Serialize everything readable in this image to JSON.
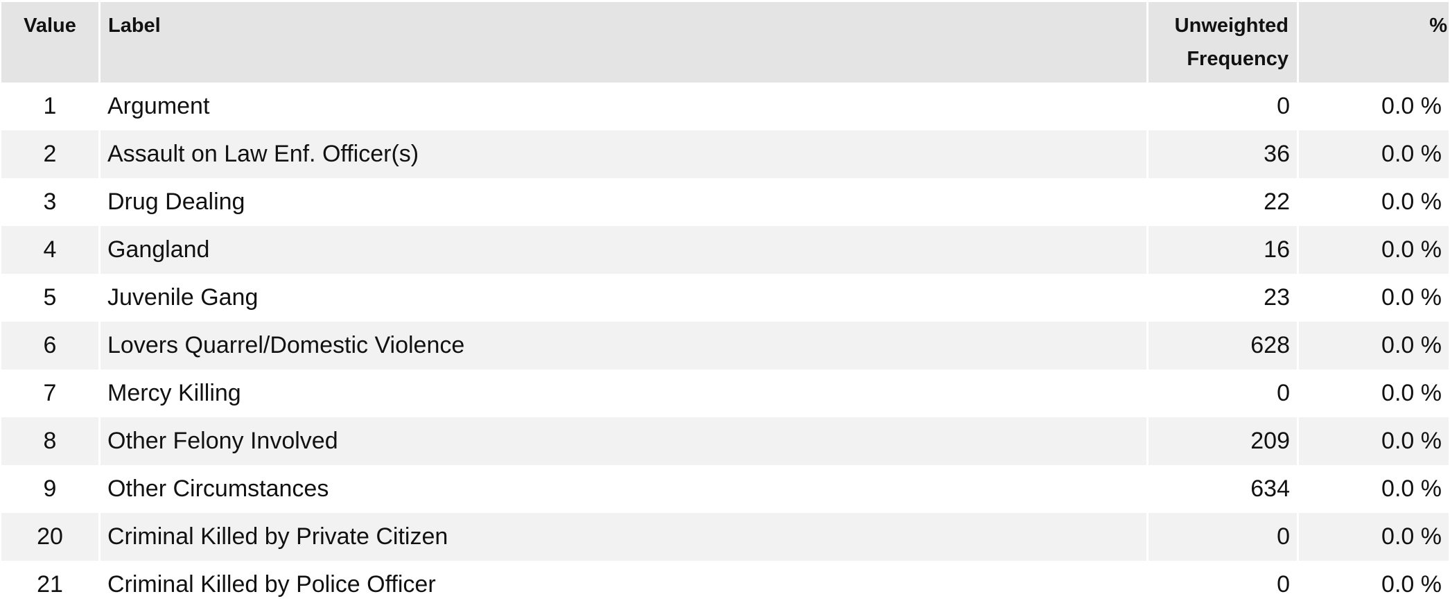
{
  "table": {
    "headers": {
      "value": "Value",
      "label": "Label",
      "freq_line1": "Unweighted",
      "freq_line2": "Frequency",
      "pct": "%"
    },
    "rows": [
      {
        "value": "1",
        "label": "Argument",
        "freq": "0",
        "pct": "0.0 %"
      },
      {
        "value": "2",
        "label": "Assault on Law Enf. Officer(s)",
        "freq": "36",
        "pct": "0.0 %"
      },
      {
        "value": "3",
        "label": "Drug Dealing",
        "freq": "22",
        "pct": "0.0 %"
      },
      {
        "value": "4",
        "label": "Gangland",
        "freq": "16",
        "pct": "0.0 %"
      },
      {
        "value": "5",
        "label": "Juvenile Gang",
        "freq": "23",
        "pct": "0.0 %"
      },
      {
        "value": "6",
        "label": "Lovers Quarrel/Domestic Violence",
        "freq": "628",
        "pct": "0.0 %"
      },
      {
        "value": "7",
        "label": "Mercy Killing",
        "freq": "0",
        "pct": "0.0 %"
      },
      {
        "value": "8",
        "label": "Other Felony Involved",
        "freq": "209",
        "pct": "0.0 %"
      },
      {
        "value": "9",
        "label": "Other Circumstances",
        "freq": "634",
        "pct": "0.0 %"
      },
      {
        "value": "20",
        "label": "Criminal Killed by Private Citizen",
        "freq": "0",
        "pct": "0.0 %"
      },
      {
        "value": "21",
        "label": "Criminal Killed by Police Officer",
        "freq": "0",
        "pct": "0.0 %"
      }
    ]
  },
  "colors": {
    "header_bg": "#e4e4e4",
    "stripe_bg": "#f2f2f2",
    "row_bg": "#ffffff",
    "text": "#111111"
  }
}
